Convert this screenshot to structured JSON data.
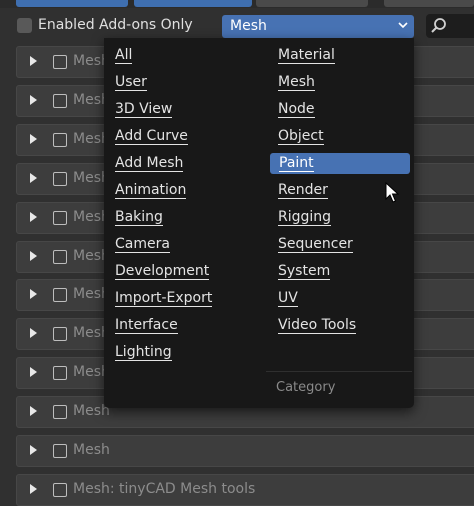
{
  "filter": {
    "enabled_only_label": "Enabled Add-ons Only"
  },
  "category_dropdown": {
    "value": "Mesh"
  },
  "rows": [
    {
      "label": "Mesh"
    },
    {
      "label": "Mesh"
    },
    {
      "label": "Mesh"
    },
    {
      "label": "Mesh"
    },
    {
      "label": "Mesh"
    },
    {
      "label": "Mesh"
    },
    {
      "label": "Mesh"
    },
    {
      "label": "Mesh"
    },
    {
      "label": "Mesh"
    },
    {
      "label": "Mesh"
    },
    {
      "label": "Mesh"
    },
    {
      "label": "Mesh: tinyCAD Mesh tools"
    }
  ],
  "menu": {
    "left_column": [
      "All",
      "User",
      "3D View",
      "Add Curve",
      "Add Mesh",
      "Animation",
      "Baking",
      "Camera",
      "Development",
      "Import-Export",
      "Interface",
      "Lighting"
    ],
    "right_column": [
      "Material",
      "Mesh",
      "Node",
      "Object",
      "Paint",
      "Render",
      "Rigging",
      "Sequencer",
      "System",
      "UV",
      "Video Tools"
    ],
    "highlighted": "Paint",
    "footer": "Category"
  },
  "colors": {
    "accent": "#4772b3",
    "panel": "#3d3d3d",
    "menu_bg": "#181818"
  }
}
